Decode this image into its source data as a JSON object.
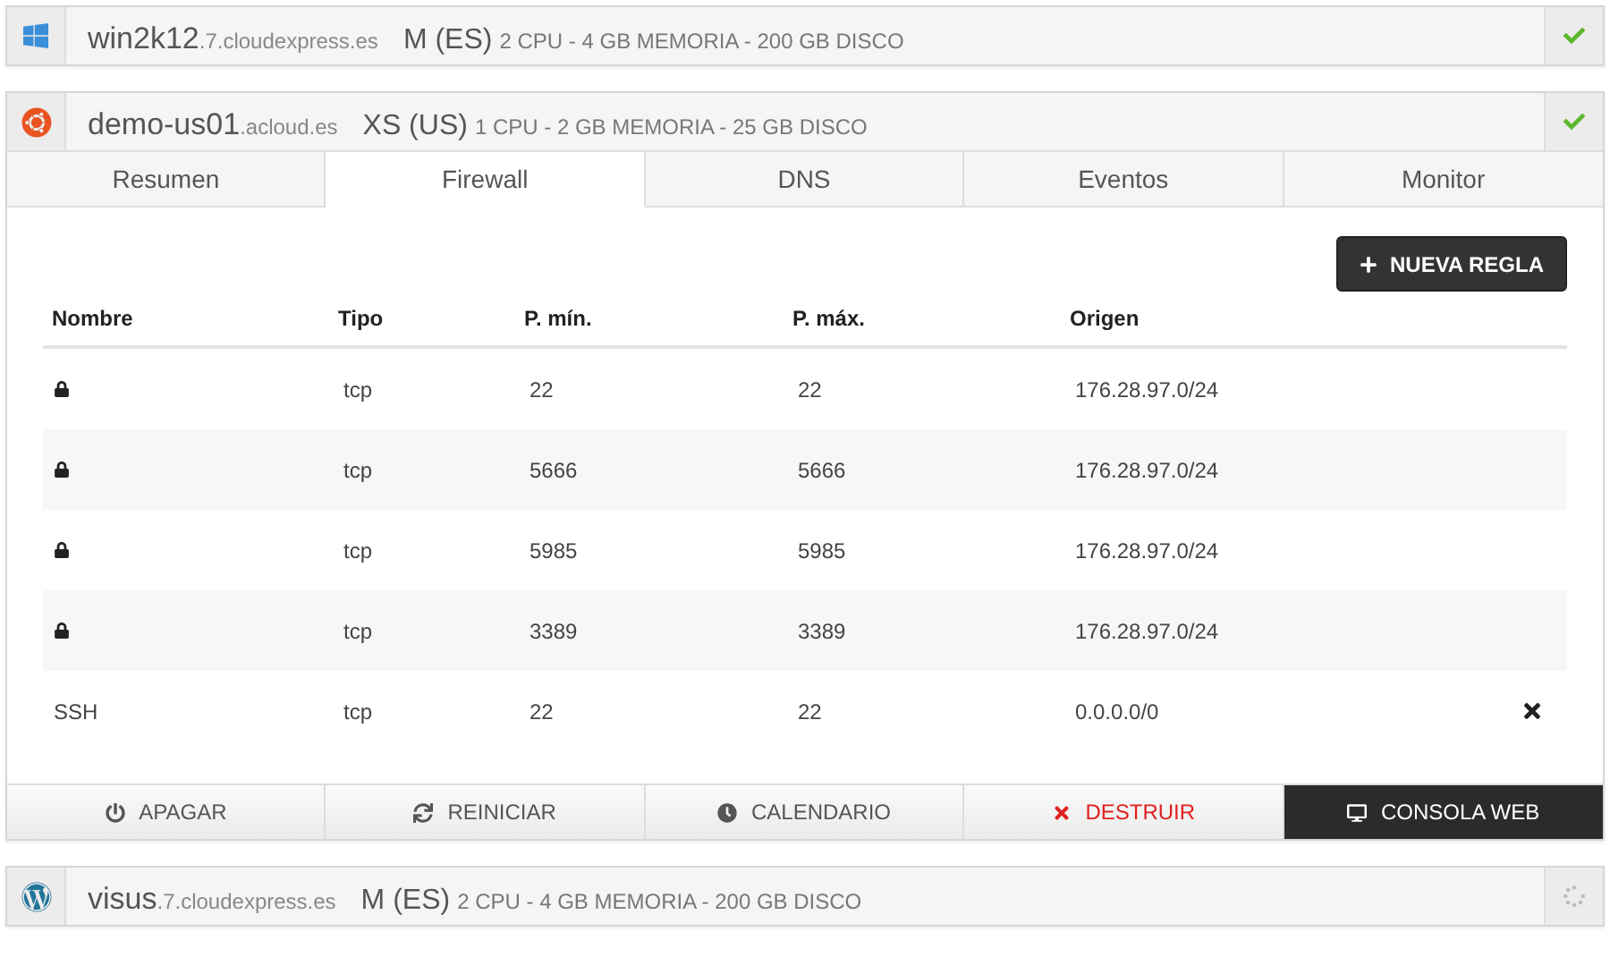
{
  "servers": [
    {
      "kind": "windows",
      "name": "win2k12",
      "domain": ".7.cloudexpress.es",
      "plan": "M (ES)",
      "specs": "2 CPU - 4 GB MEMORIA - 200 GB DISCO",
      "ready": true,
      "expanded": false
    },
    {
      "kind": "ubuntu",
      "name": "demo-us01",
      "domain": ".acloud.es",
      "plan": "XS (US)",
      "specs": "1 CPU - 2 GB MEMORIA - 25 GB DISCO",
      "ready": true,
      "expanded": true,
      "tabs": [
        {
          "label": "Resumen",
          "selected": false
        },
        {
          "label": "Firewall",
          "selected": true
        },
        {
          "label": "DNS",
          "selected": false
        },
        {
          "label": "Eventos",
          "selected": false
        },
        {
          "label": "Monitor",
          "selected": false
        }
      ],
      "new_rule_button": "NUEVA REGLA",
      "table": {
        "columns": [
          "Nombre",
          "Tipo",
          "P. mín.",
          "P. máx.",
          "Origen"
        ],
        "rows": [
          {
            "locked": true,
            "type": "tcp",
            "min": "22",
            "max": "22",
            "origin": "176.28.97.0/24"
          },
          {
            "locked": true,
            "type": "tcp",
            "min": "5666",
            "max": "5666",
            "origin": "176.28.97.0/24"
          },
          {
            "locked": true,
            "type": "tcp",
            "min": "5985",
            "max": "5985",
            "origin": "176.28.97.0/24"
          },
          {
            "locked": true,
            "type": "tcp",
            "min": "3389",
            "max": "3389",
            "origin": "176.28.97.0/24"
          },
          {
            "locked": false,
            "name": "SSH",
            "type": "tcp",
            "min": "22",
            "max": "22",
            "origin": "0.0.0.0/0"
          }
        ]
      },
      "actions": [
        {
          "kind": "power",
          "label": "APAGAR"
        },
        {
          "kind": "restart",
          "label": "REINICIAR"
        },
        {
          "kind": "calendar",
          "label": "CALENDARIO"
        },
        {
          "kind": "destroy",
          "label": "DESTRUIR"
        },
        {
          "kind": "console",
          "label": "CONSOLA WEB"
        }
      ]
    },
    {
      "kind": "wordpress",
      "name": "visus",
      "domain": ".7.cloudexpress.es",
      "plan": "M (ES)",
      "specs": "2 CPU - 4 GB MEMORIA - 200 GB DISCO",
      "ready": false,
      "expanded": false
    }
  ]
}
